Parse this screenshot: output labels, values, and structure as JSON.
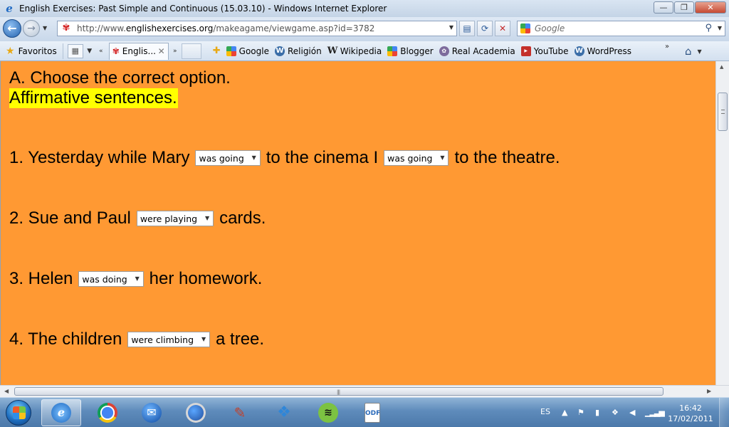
{
  "window": {
    "title": "English Exercises: Past Simple and Continuous (15.03.10) - Windows Internet Explorer",
    "app_icon": "ie-icon",
    "controls": {
      "minimize": "—",
      "maximize": "❐",
      "close": "✕"
    }
  },
  "address_bar": {
    "url_prefix": "http://www.",
    "url_domain": "englishexercises.org",
    "url_path": "/makeagame/viewgame.asp?id=3782",
    "search_placeholder": "Google"
  },
  "favorites_bar": {
    "favorites_label": "Favoritos",
    "tab_title": "Englis...",
    "links": [
      {
        "label": "Google",
        "icon": "google-icon"
      },
      {
        "label": "Religión",
        "icon": "wordpress-icon"
      },
      {
        "label": "Wikipedia",
        "icon": "wikipedia-icon"
      },
      {
        "label": "Blogger",
        "icon": "google-icon"
      },
      {
        "label": "Real Academia",
        "icon": "rae-icon"
      },
      {
        "label": "YouTube",
        "icon": "youtube-icon"
      },
      {
        "label": "WordPress",
        "icon": "wordpress-icon"
      }
    ]
  },
  "page": {
    "background_color": "#ff9933",
    "highlight_color": "#ffff00",
    "heading": "A. Choose the correct option.",
    "subheading": "Affirmative sentences.",
    "questions": [
      {
        "segments": [
          "1. Yesterday while Mary",
          "to the cinema I",
          "to the theatre."
        ],
        "selects": [
          "was going",
          "was going"
        ]
      },
      {
        "segments": [
          "2. Sue and Paul",
          "cards."
        ],
        "selects": [
          "were playing"
        ]
      },
      {
        "segments": [
          "3. Helen",
          "her homework."
        ],
        "selects": [
          "was doing"
        ]
      },
      {
        "segments": [
          "4. The children",
          "a tree."
        ],
        "selects": [
          "were climbing"
        ]
      }
    ]
  },
  "taskbar": {
    "items": [
      "start-button",
      "internet-explorer",
      "chrome",
      "windows-live-mail",
      "google-earth",
      "paint",
      "dropbox",
      "spotify",
      "document"
    ],
    "language": "ES",
    "time": "16:42",
    "date": "17/02/2011"
  }
}
